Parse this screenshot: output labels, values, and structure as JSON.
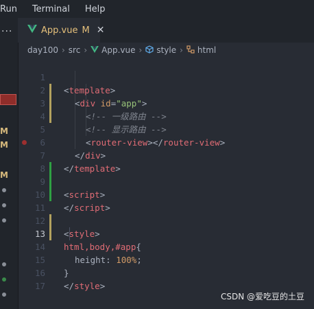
{
  "menu": {
    "items": [
      "Run",
      "Terminal",
      "Help"
    ]
  },
  "tab": {
    "filename": "App.vue",
    "status": "M",
    "close": "✕"
  },
  "breadcrumb": {
    "items": [
      "day100",
      "src",
      "App.vue",
      "style",
      "html"
    ]
  },
  "sidebar": {
    "dots": "···",
    "marks": [
      "M",
      "M",
      "M"
    ]
  },
  "code": {
    "line_numbers": [
      "1",
      "2",
      "3",
      "4",
      "5",
      "6",
      "7",
      "8",
      "9",
      "10",
      "11",
      "12",
      "13",
      "14",
      "15",
      "16",
      "17"
    ],
    "l1": {
      "open": "<",
      "tag": "template",
      "close": ">"
    },
    "l2": {
      "open": "<",
      "tag": "div",
      "attr": " id",
      "eq": "=",
      "str": "\"app\"",
      "close": ">"
    },
    "l3": {
      "comment": "<!-- 一级路由 -->"
    },
    "l4": {
      "comment": "<!-- 显示路由 -->"
    },
    "l5": {
      "open": "<",
      "tag": "router-view",
      "mid": "></",
      "tag2": "router-view",
      "close": ">"
    },
    "l6": {
      "open": "</",
      "tag": "div",
      "close": ">"
    },
    "l7": {
      "open": "</",
      "tag": "template",
      "close": ">"
    },
    "l9": {
      "open": "<",
      "tag": "script",
      "close": ">"
    },
    "l10": {
      "open": "</",
      "tag": "script",
      "close": ">"
    },
    "l12": {
      "open": "<",
      "tag": "style",
      "close": ">"
    },
    "l13": {
      "selector": "html,body,#app",
      "brace": "{"
    },
    "l14": {
      "prop": "height",
      "colon": ": ",
      "num": "100%",
      "semi": ";"
    },
    "l15": {
      "brace": "}"
    },
    "l16": {
      "open": "</",
      "tag": "style",
      "close": ">"
    }
  },
  "watermark": "CSDN @爱吃豆的土豆",
  "colors": {
    "vue_green": "#42b883",
    "modified": "#e5c07b",
    "added": "#2ea043",
    "changed": "#b3a25e"
  }
}
